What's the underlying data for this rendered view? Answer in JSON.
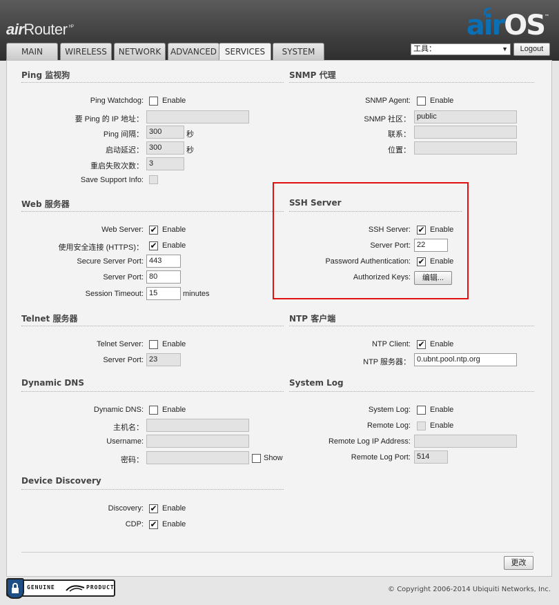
{
  "header": {
    "brand_air": "air",
    "brand_router": "Router",
    "brand_hp": "HP",
    "logo_air": "air",
    "logo_os": "OS",
    "logo_tm": "™"
  },
  "tabs": [
    {
      "label": "MAIN"
    },
    {
      "label": "WIRELESS"
    },
    {
      "label": "NETWORK"
    },
    {
      "label": "ADVANCED"
    },
    {
      "label": "SERVICES",
      "active": true
    },
    {
      "label": "SYSTEM"
    }
  ],
  "toolbar": {
    "tools_select_value": "工具：",
    "logout_label": "Logout"
  },
  "ping": {
    "title": "Ping 监视狗",
    "watchdog_label": "Ping Watchdog:",
    "watchdog_enable": "Enable",
    "ip_label": "要 Ping 的 IP 地址：",
    "ip_value": "",
    "interval_label": "Ping 间隔：",
    "interval_value": "300",
    "interval_unit": "秒",
    "delay_label": "启动延迟：",
    "delay_value": "300",
    "delay_unit": "秒",
    "failures_label": "重启失败次数：",
    "failures_value": "3",
    "support_label": "Save Support Info:"
  },
  "snmp": {
    "title": "SNMP 代理",
    "agent_label": "SNMP Agent:",
    "agent_enable": "Enable",
    "community_label": "SNMP 社区：",
    "community_value": "public",
    "contact_label": "联系：",
    "contact_value": "",
    "location_label": "位置：",
    "location_value": ""
  },
  "web": {
    "title": "Web 服务器",
    "server_label": "Web Server:",
    "server_enable": "Enable",
    "https_label": "使用安全连接 (HTTPS)：",
    "https_enable": "Enable",
    "secure_port_label": "Secure Server Port:",
    "secure_port_value": "443",
    "port_label": "Server Port:",
    "port_value": "80",
    "timeout_label": "Session Timeout:",
    "timeout_value": "15",
    "timeout_unit": "minutes"
  },
  "ssh": {
    "title": "SSH Server",
    "server_label": "SSH Server:",
    "server_enable": "Enable",
    "port_label": "Server Port:",
    "port_value": "22",
    "pwauth_label": "Password Authentication:",
    "pwauth_enable": "Enable",
    "keys_label": "Authorized Keys:",
    "keys_button": "编辑..."
  },
  "telnet": {
    "title": "Telnet 服务器",
    "server_label": "Telnet Server:",
    "server_enable": "Enable",
    "port_label": "Server Port:",
    "port_value": "23"
  },
  "ntp": {
    "title": "NTP 客户端",
    "client_label": "NTP Client:",
    "client_enable": "Enable",
    "server_label": "NTP 服务器：",
    "server_value": "0.ubnt.pool.ntp.org"
  },
  "ddns": {
    "title": "Dynamic DNS",
    "ddns_label": "Dynamic DNS:",
    "ddns_enable": "Enable",
    "host_label": "主机名：",
    "host_value": "",
    "user_label": "Username:",
    "user_value": "",
    "pass_label": "密码：",
    "pass_value": "",
    "show_label": "Show"
  },
  "syslog": {
    "title": "System Log",
    "syslog_label": "System Log:",
    "syslog_enable": "Enable",
    "remote_label": "Remote Log:",
    "remote_enable": "Enable",
    "remote_ip_label": "Remote Log IP Address:",
    "remote_ip_value": "",
    "remote_port_label": "Remote Log Port:",
    "remote_port_value": "514"
  },
  "discovery": {
    "title": "Device Discovery",
    "discovery_label": "Discovery:",
    "discovery_enable": "Enable",
    "cdp_label": "CDP:",
    "cdp_enable": "Enable"
  },
  "actions": {
    "change_label": "更改"
  },
  "footer": {
    "badge_left": "GENUINE",
    "badge_right": "PRODUCT",
    "copyright": "© Copyright 2006-2014 Ubiquiti Networks, Inc."
  }
}
